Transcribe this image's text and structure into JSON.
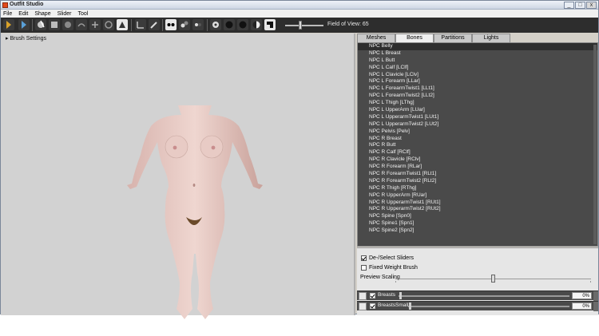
{
  "window": {
    "title": "Outfit Studio",
    "controls": [
      "_",
      "□",
      "x"
    ]
  },
  "menu": [
    "File",
    "Edit",
    "Shape",
    "Slider",
    "Tool"
  ],
  "toolbar": {
    "icons": [
      "select-icon",
      "transform-icon",
      "inflate-brush-icon",
      "deflate-brush-icon",
      "move-brush-icon",
      "smooth-brush-icon",
      "undiff-brush-icon",
      "mask-brush-icon",
      "unmask-brush-icon",
      "weight-brush-icon",
      "color-brush-icon",
      "axis-icon",
      "pen-icon",
      "vertex-view-icon",
      "mask-view-icon",
      "backface-icon",
      "light-icon",
      "texture-icon",
      "wireframe-icon",
      "lighting-icon",
      "edge-view-icon"
    ],
    "fov_label": "Field of View: 65",
    "fov_value": 65
  },
  "viewport": {
    "brush_settings_label": "Brush Settings"
  },
  "tabs": [
    {
      "label": "Meshes",
      "active": false
    },
    {
      "label": "Bones",
      "active": true
    },
    {
      "label": "Partitions",
      "active": false
    },
    {
      "label": "Lights",
      "active": false
    }
  ],
  "bones": [
    "NPC Belly",
    "NPC L Breast",
    "NPC L Butt",
    "NPC L Calf [LClf]",
    "NPC L Clavicle [LClv]",
    "NPC L Forearm [LLar]",
    "NPC L ForearmTwist1 [LLt1]",
    "NPC L ForearmTwist2 [LLt2]",
    "NPC L Thigh [LThg]",
    "NPC L UpperArm [LUar]",
    "NPC L UpperarmTwist1 [LUt1]",
    "NPC L UpperarmTwist2 [LUt2]",
    "NPC Pelvis [Pelv]",
    "NPC R Breast",
    "NPC R Butt",
    "NPC R Calf [RClf]",
    "NPC R Clavicle [RClv]",
    "NPC R Forearm [RLar]",
    "NPC R ForearmTwist1 [RLt1]",
    "NPC R ForearmTwist2 [RLt2]",
    "NPC R Thigh [RThg]",
    "NPC R UpperArm [RUar]",
    "NPC R UpperarmTwist1 [RUt1]",
    "NPC R UpperarmTwist2 [RUt2]",
    "NPC Spine [Spn0]",
    "NPC Spine1 [Spn1]",
    "NPC Spine2 [Spn2]"
  ],
  "controls": {
    "deselect_sliders": {
      "label": "De-/Select Sliders",
      "checked": true
    },
    "fixed_weight_brush": {
      "label": "Fixed Weight Brush",
      "checked": false
    },
    "preview_scaling_label": "Preview Scaling",
    "preview_scaling_value": 0.5
  },
  "sliders": [
    {
      "name": "Breasts",
      "value_text": "0%",
      "checked": true
    },
    {
      "name": "BreastsSmall",
      "value_text": "0%",
      "checked": true
    }
  ],
  "colors": {
    "toolbar_bg": "#2d2d2d",
    "list_bg": "#4a4a4a",
    "viewport_bg": "#d2d2d2",
    "skin": "#e6c8c2"
  }
}
